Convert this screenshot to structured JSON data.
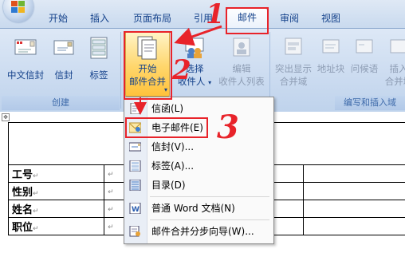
{
  "tabs": [
    "开始",
    "插入",
    "页面布局",
    "引用",
    "邮件",
    "审阅",
    "视图"
  ],
  "active_tab": "邮件",
  "ribbon": {
    "create_group": {
      "caption": "创建",
      "buttons": [
        "中文信封",
        "信封",
        "标签"
      ]
    },
    "start_merge": {
      "line1": "开始",
      "line2": "邮件合并"
    },
    "select_recipients": {
      "line1": "选择",
      "line2": "收件人"
    },
    "edit_recipients": {
      "line1": "编辑",
      "line2": "收件人列表"
    },
    "right_group": {
      "caption": "编写和插入域",
      "highlight": {
        "line1": "突出显示",
        "line2": "合并域"
      },
      "address_block": "地址块",
      "greeting": "问候语",
      "insert_merge": {
        "line1": "插入",
        "line2": "合并域"
      }
    }
  },
  "menu": {
    "items": [
      {
        "label": "信函(L)",
        "icon": "letter-icon"
      },
      {
        "label": "电子邮件(E)",
        "icon": "email-icon"
      },
      {
        "label": "信封(V)...",
        "icon": "envelope-icon"
      },
      {
        "label": "标签(A)...",
        "icon": "label-icon"
      },
      {
        "label": "目录(D)",
        "icon": "directory-icon"
      },
      {
        "label": "普通 Word 文档(N)",
        "icon": "word-doc-icon"
      },
      {
        "label": "邮件合并分步向导(W)...",
        "icon": "wizard-icon"
      }
    ]
  },
  "doc": {
    "rows": [
      "工号",
      "性别",
      "姓名",
      "职位"
    ],
    "cell_mark": "↵"
  },
  "annotations": [
    "1",
    "2",
    "3"
  ],
  "colors": {
    "annotation": "#e8232a",
    "ribbon": "#c8d9ee",
    "text": "#15428b"
  }
}
